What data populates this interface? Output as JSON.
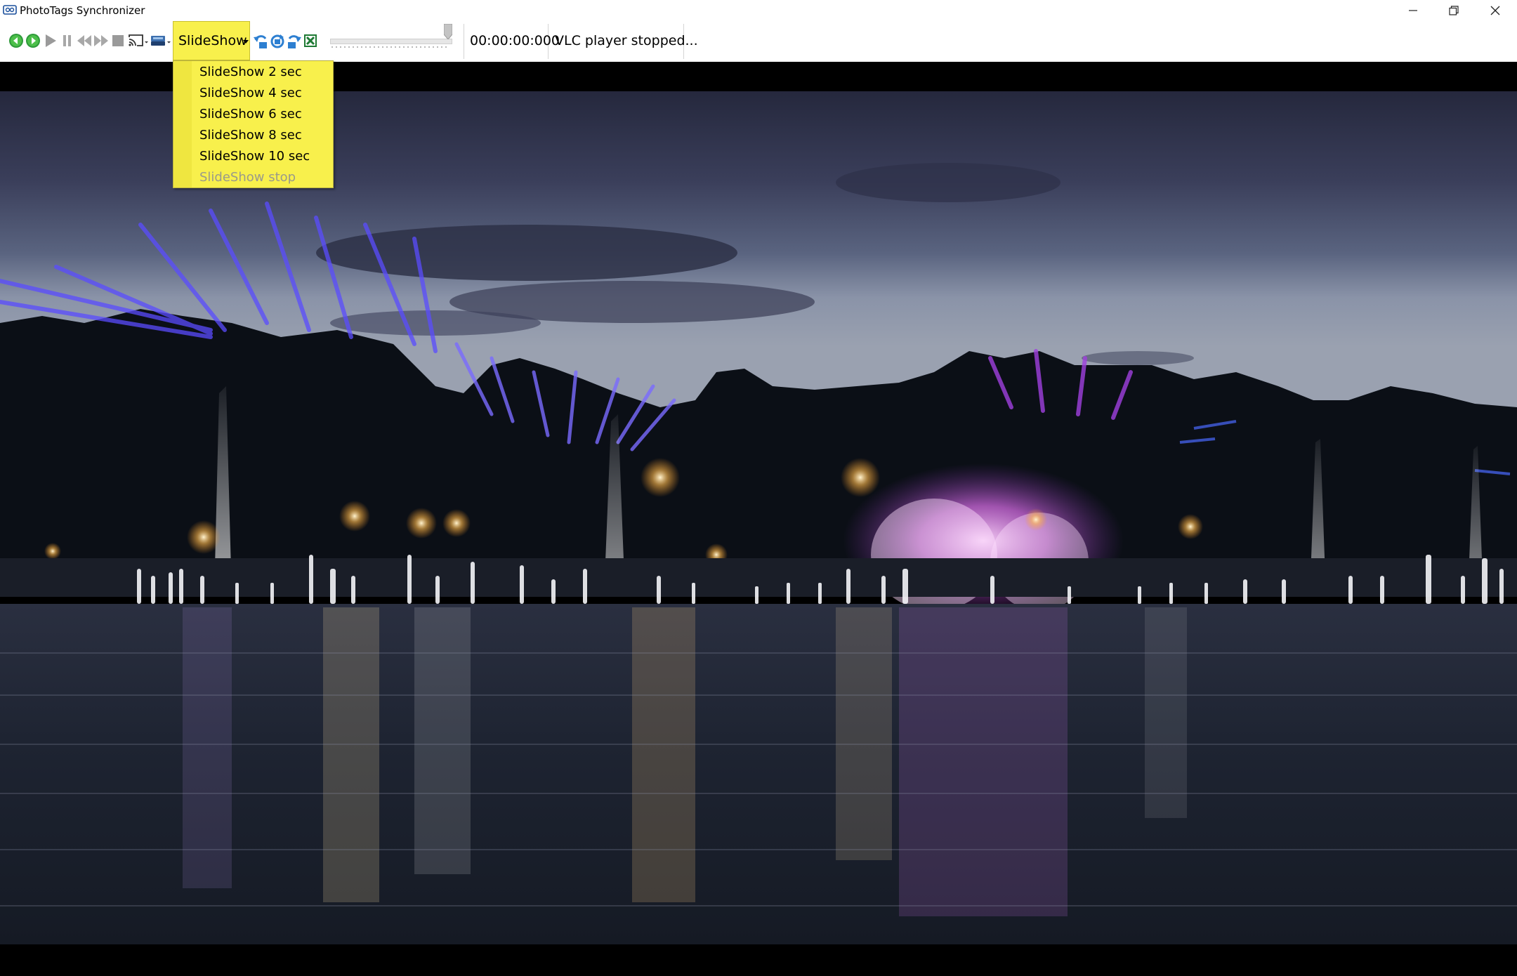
{
  "window": {
    "title": "PhotoTags Synchronizer"
  },
  "toolbar": {
    "slideshow_label": "SlideShow",
    "time": "00:00:00:000",
    "status": "VLC player stopped..."
  },
  "slideshow_menu": {
    "items": [
      {
        "label": "SlideShow 2 sec",
        "enabled": true
      },
      {
        "label": "SlideShow 4 sec",
        "enabled": true
      },
      {
        "label": "SlideShow 6 sec",
        "enabled": true
      },
      {
        "label": "SlideShow 8 sec",
        "enabled": true
      },
      {
        "label": "SlideShow 10 sec",
        "enabled": true
      },
      {
        "label": "SlideShow stop",
        "enabled": false
      }
    ]
  },
  "colors": {
    "highlight": "#f8f04c",
    "nav_green": "#2e9a3a",
    "toolbar_gray": "#9a9a9a",
    "rotate_blue": "#2d7fd1",
    "background": "#000000"
  },
  "icons": [
    "app-icon",
    "back-icon",
    "forward-icon",
    "play-icon",
    "pause-icon",
    "previous-icon",
    "next-icon",
    "stop-icon",
    "cast-icon",
    "chromecast-icon",
    "rotate-left-icon",
    "rotate-180-icon",
    "rotate-right-icon",
    "close-x-icon",
    "minimize-icon",
    "maximize-icon",
    "close-icon"
  ]
}
